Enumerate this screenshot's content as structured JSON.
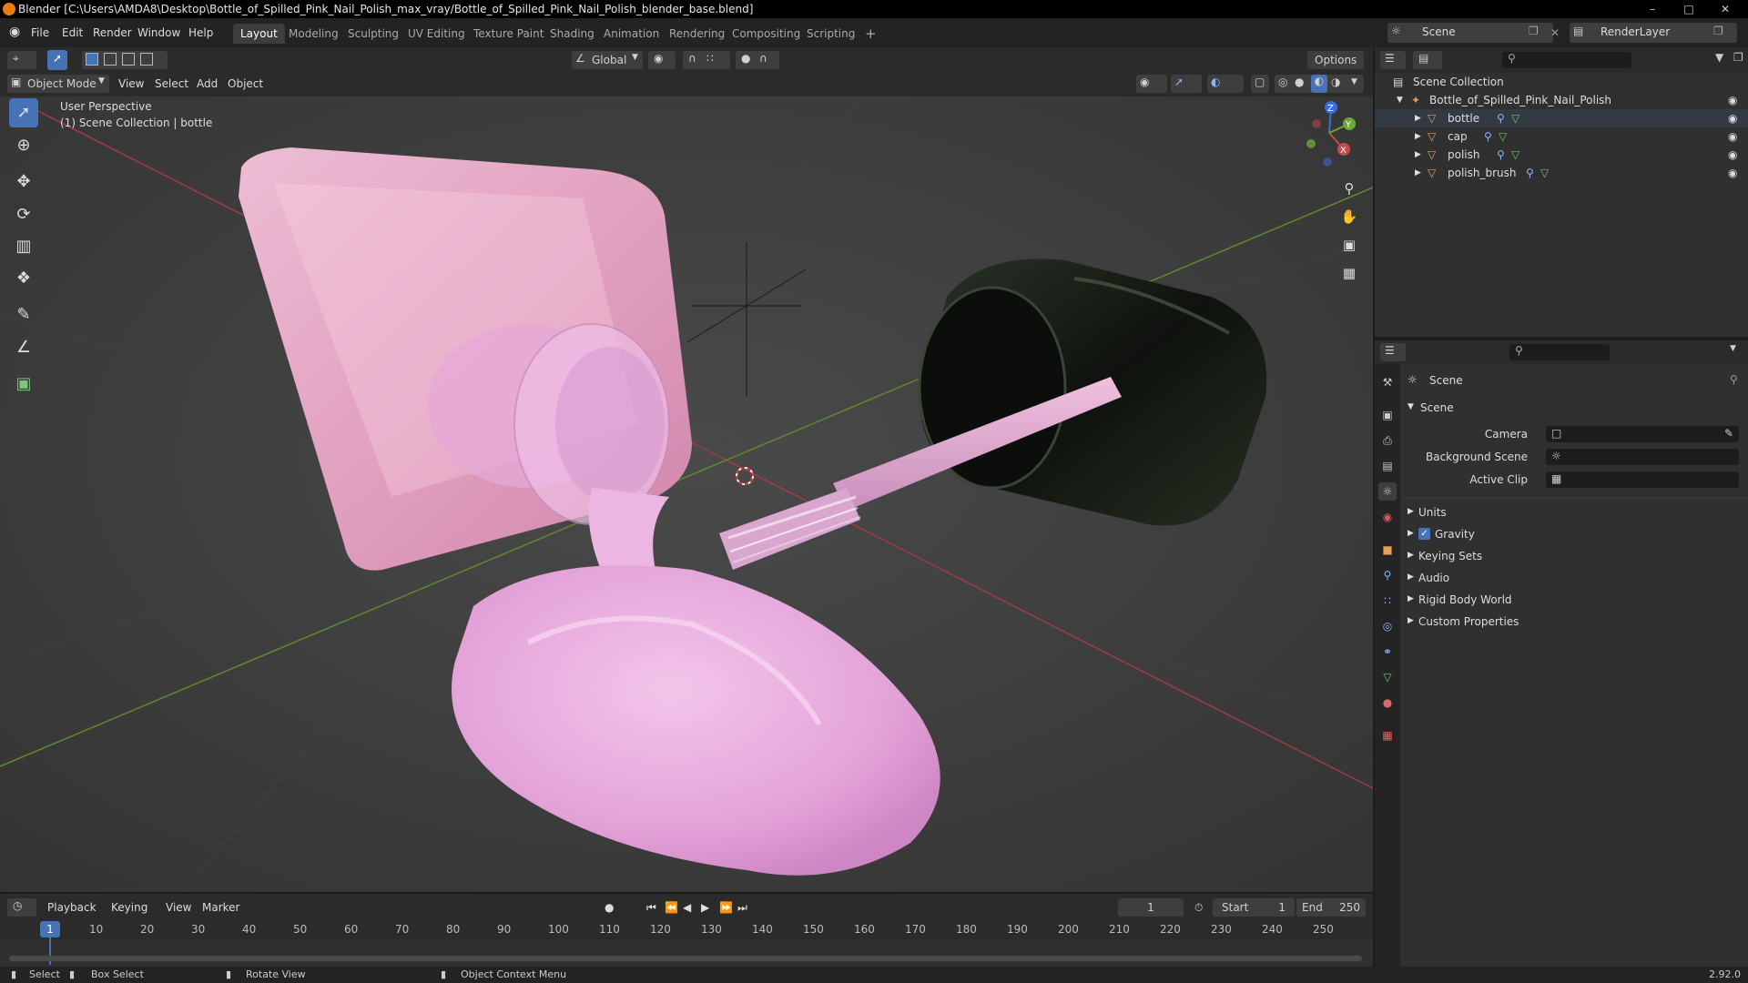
{
  "window": {
    "title": "Blender [C:\\Users\\AMDA8\\Desktop\\Bottle_of_Spilled_Pink_Nail_Polish_max_vray/Bottle_of_Spilled_Pink_Nail_Polish_blender_base.blend]"
  },
  "menu": [
    "File",
    "Edit",
    "Render",
    "Window",
    "Help"
  ],
  "workspaces": [
    "Layout",
    "Modeling",
    "Sculpting",
    "UV Editing",
    "Texture Paint",
    "Shading",
    "Animation",
    "Rendering",
    "Compositing",
    "Scripting"
  ],
  "scene_selector": {
    "scene": "Scene",
    "view_layer": "RenderLayer"
  },
  "tool_header": {
    "transform_orientation": "Global",
    "options": "Options"
  },
  "viewport_header": {
    "mode": "Object Mode",
    "items": [
      "View",
      "Select",
      "Add",
      "Object"
    ]
  },
  "viewport": {
    "perspective_label": "User Perspective",
    "collection_label": "(1) Scene Collection | bottle",
    "gizmo_axes": [
      "Z",
      "Y",
      "X"
    ]
  },
  "outliner": {
    "root": "Scene Collection",
    "collection": "Bottle_of_Spilled_Pink_Nail_Polish",
    "objects": [
      "bottle",
      "cap",
      "polish",
      "polish_brush"
    ]
  },
  "properties": {
    "header": "Scene",
    "panel": "Scene",
    "fields": {
      "camera_label": "Camera",
      "background_scene_label": "Background Scene",
      "active_clip_label": "Active Clip"
    },
    "sections": [
      "Units",
      "Gravity",
      "Keying Sets",
      "Audio",
      "Rigid Body World",
      "Custom Properties"
    ],
    "gravity_checked": true
  },
  "timeline": {
    "menus": [
      "Playback",
      "Keying",
      "View",
      "Marker"
    ],
    "current_frame": "1",
    "start_label": "Start",
    "start": "1",
    "end_label": "End",
    "end": "250",
    "ticks": [
      "10",
      "20",
      "30",
      "40",
      "50",
      "60",
      "70",
      "80",
      "90",
      "100",
      "110",
      "120",
      "130",
      "140",
      "150",
      "160",
      "170",
      "180",
      "190",
      "200",
      "210",
      "220",
      "230",
      "240",
      "250"
    ],
    "playhead_label": "1"
  },
  "statusbar": {
    "select": "Select",
    "box_select": "Box Select",
    "rotate_view": "Rotate View",
    "context_menu": "Object Context Menu",
    "version": "2.92.0"
  },
  "colors": {
    "accent": "#4772b3",
    "pink_polish": "#e8a6dc",
    "bottle_pink": "#f2b3cf",
    "cap_black": "#1a1f18",
    "x_axis": "#c44c4c",
    "y_axis": "#6a9a3a"
  }
}
